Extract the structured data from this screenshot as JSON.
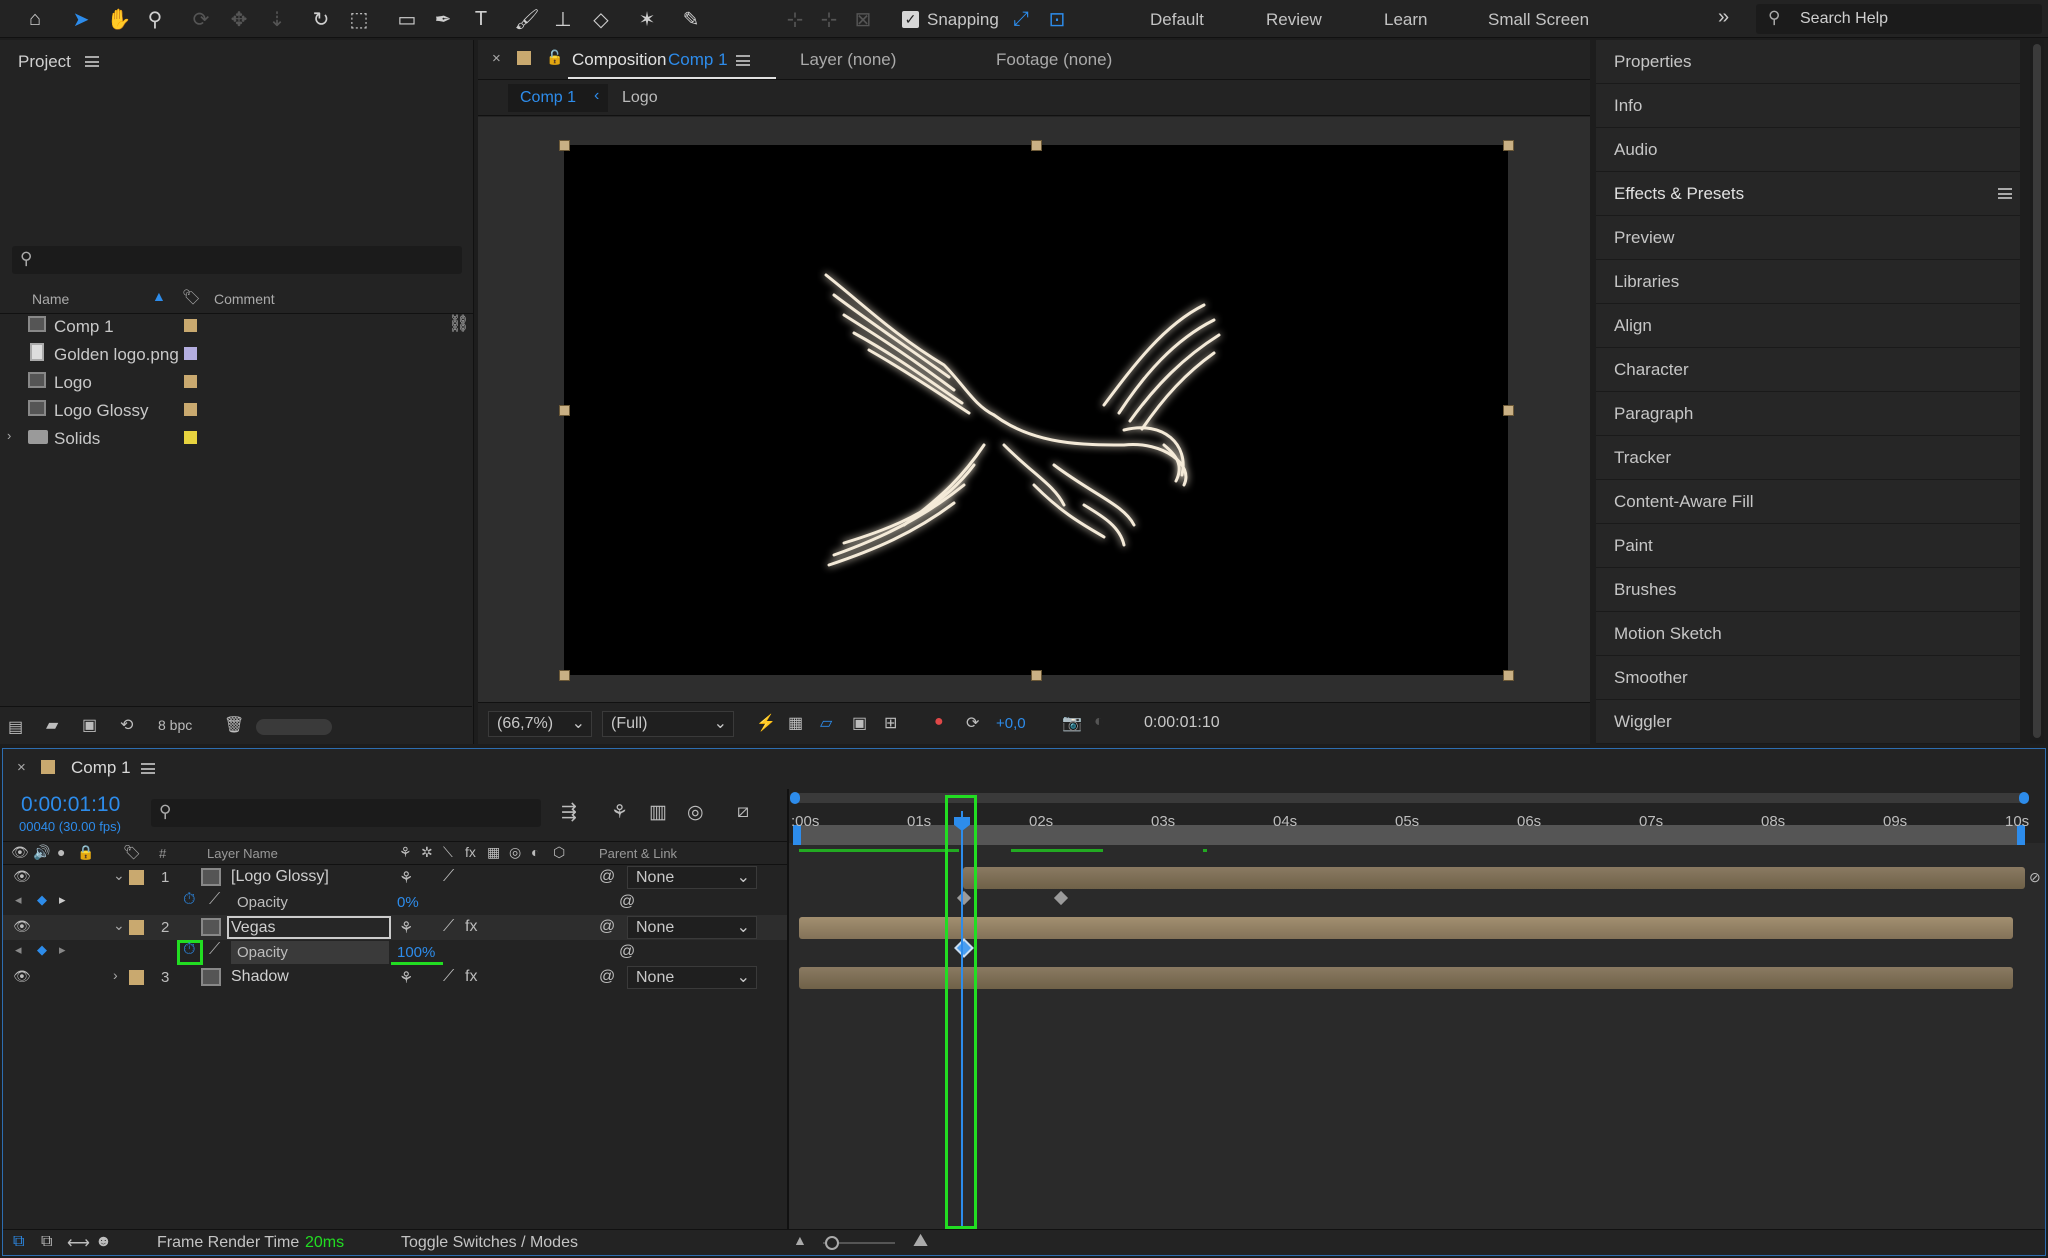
{
  "workspaces": [
    "Default",
    "Review",
    "Learn",
    "Small Screen"
  ],
  "toolbar": {
    "snapping_label": "Snapping",
    "search_placeholder": "Search Help"
  },
  "project": {
    "title": "Project",
    "columns": {
      "name": "Name",
      "comment": "Comment"
    },
    "items": [
      {
        "name": "Comp 1",
        "color": "#c9a96f"
      },
      {
        "name": "Golden logo.png",
        "color": "#b4aee0"
      },
      {
        "name": "Logo",
        "color": "#c9a96f"
      },
      {
        "name": "Logo Glossy",
        "color": "#c9a96f"
      },
      {
        "name": "Solids",
        "color": "#e7d33f"
      }
    ],
    "bpc": "8 bpc"
  },
  "comp_panel": {
    "tab_prefix": "Composition",
    "tab_comp": "Comp 1",
    "layer_tab": "Layer (none)",
    "footage_tab": "Footage (none)",
    "breadcrumb": [
      "Comp 1",
      "Logo"
    ],
    "zoom": "(66,7%)",
    "resolution": "(Full)",
    "exposure": "+0,0",
    "timecode": "0:00:01:10"
  },
  "right_panel": {
    "items": [
      "Properties",
      "Info",
      "Audio",
      "Effects & Presets",
      "Preview",
      "Libraries",
      "Align",
      "Character",
      "Paragraph",
      "Tracker",
      "Content-Aware Fill",
      "Paint",
      "Brushes",
      "Motion Sketch",
      "Smoother",
      "Wiggler"
    ]
  },
  "timeline": {
    "tab": "Comp 1",
    "current_time": "0:00:01:10",
    "frame_info": "00040 (30.00 fps)",
    "col_layer_name": "Layer Name",
    "col_parent": "Parent & Link",
    "col_num": "#",
    "ticks": [
      ":00s",
      "01s",
      "02s",
      "03s",
      "04s",
      "05s",
      "06s",
      "07s",
      "08s",
      "09s",
      "10s"
    ],
    "layers": [
      {
        "num": "1",
        "name": "[Logo Glossy]",
        "parent": "None",
        "prop": "Opacity",
        "value": "0%"
      },
      {
        "num": "2",
        "name": "Vegas",
        "parent": "None",
        "prop": "Opacity",
        "value": "100%"
      },
      {
        "num": "3",
        "name": "Shadow",
        "parent": "None"
      }
    ],
    "footer": {
      "render_label": "Frame Render Time",
      "render_value": "20ms",
      "toggle": "Toggle Switches / Modes"
    }
  },
  "colors": {
    "accent": "#2d8ceb",
    "highlight": "#22dd22",
    "label_tan": "#c9a96f"
  }
}
